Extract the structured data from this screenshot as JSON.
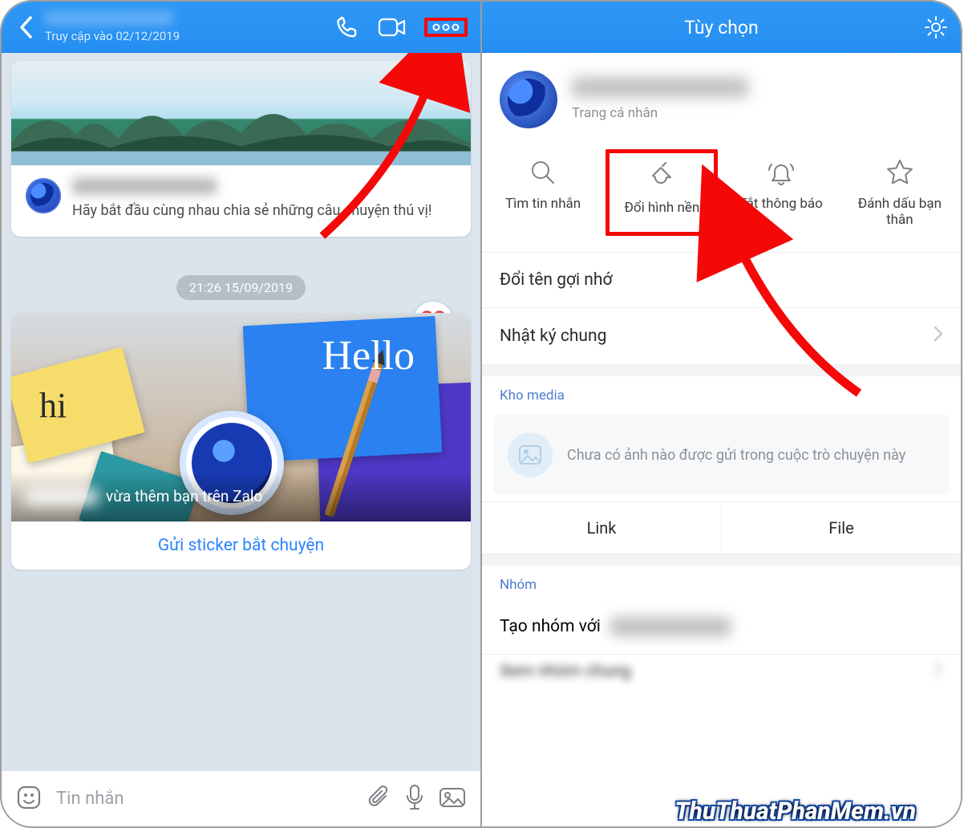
{
  "left": {
    "header": {
      "status_text": "Truy cập vào 02/12/2019"
    },
    "intro_text": "Hãy bắt đầu cùng nhau chia sẻ những câu chuyện thú vị!",
    "timestamp": "21:26 15/09/2019",
    "image_notes": {
      "hi": "hi",
      "hello": "Hello"
    },
    "added_text": "vừa thêm bạn trên Zalo",
    "sticker_btn": "Gửi sticker bắt chuyện",
    "input_placeholder": "Tin nhắn"
  },
  "right": {
    "title": "Tùy chọn",
    "profile_sub": "Trang cá nhân",
    "actions": {
      "search": "Tìm tin nhắn",
      "background": "Đổi hình nền",
      "mute": "Tắt thông báo",
      "bestfriend": "Đánh dấu bạn thân"
    },
    "rename": "Đổi tên gợi nhớ",
    "shared_diary": "Nhật ký chung",
    "media_label": "Kho media",
    "media_empty": "Chưa có ảnh nào được gửi trong cuộc trò chuyện này",
    "tab_link": "Link",
    "tab_file": "File",
    "group_label": "Nhóm",
    "create_group_prefix": "Tạo nhóm với",
    "view_common_groups": "Xem nhóm chung"
  },
  "watermark": "ThuThuatPhanMem.vn"
}
